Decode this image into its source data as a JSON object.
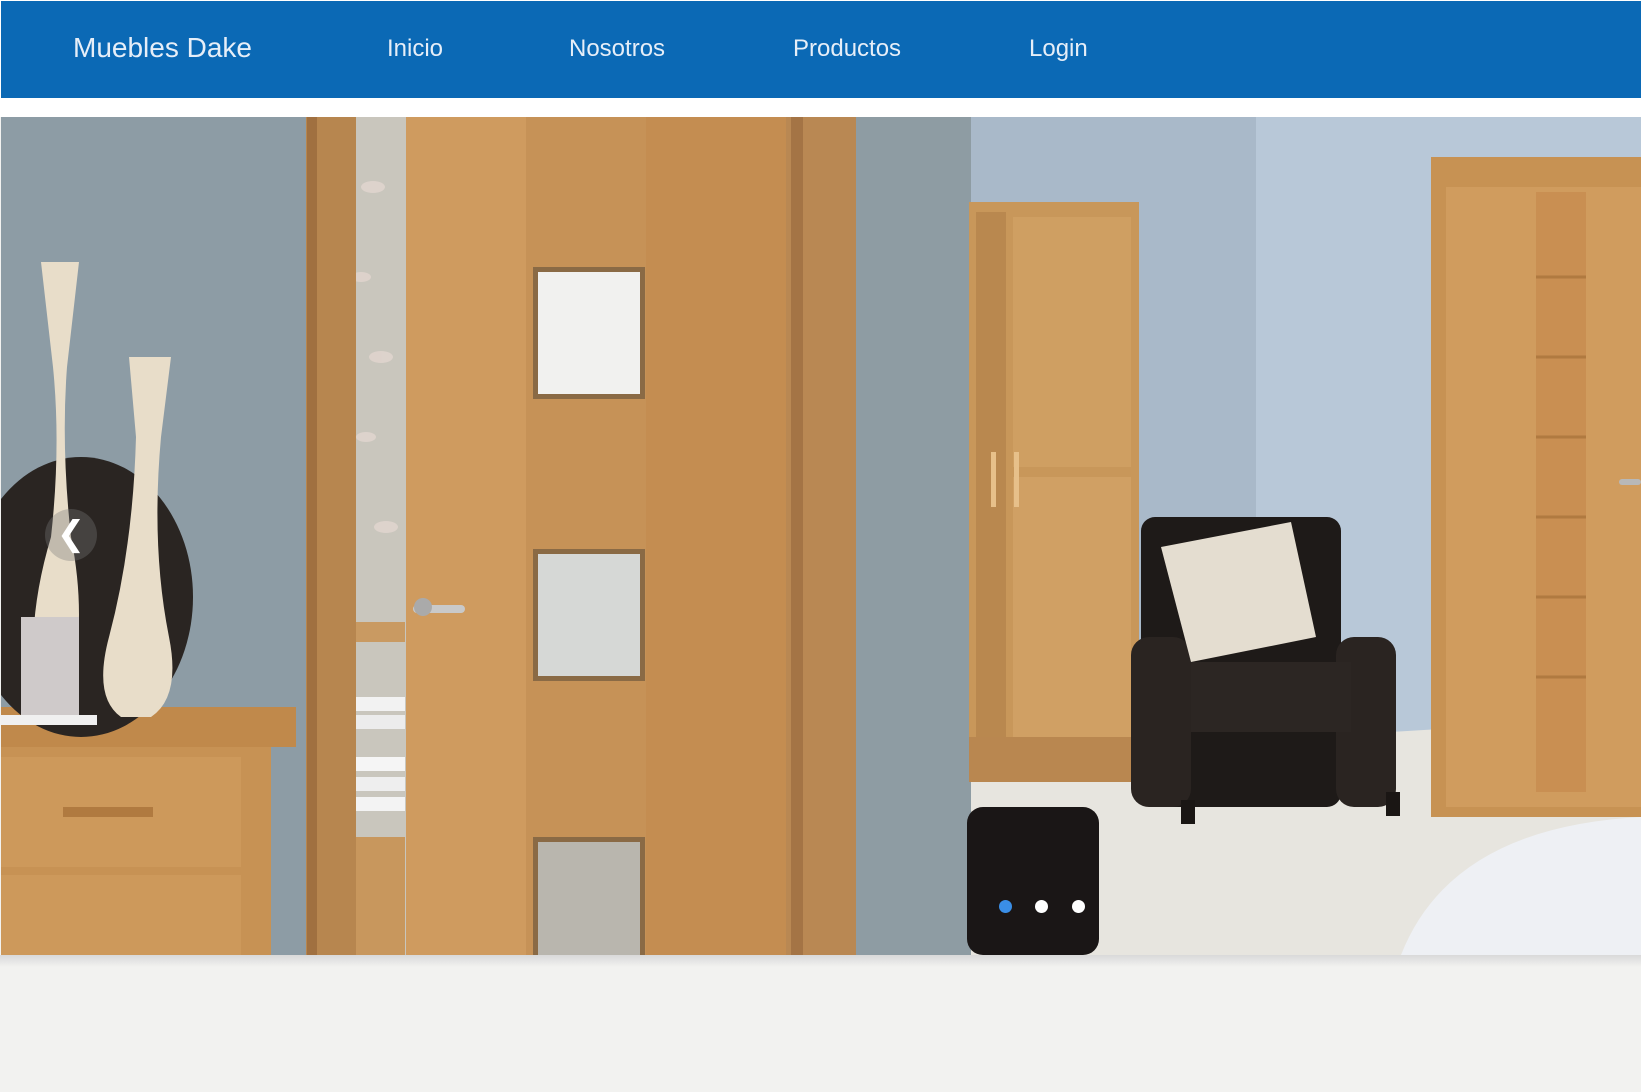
{
  "navbar": {
    "brand": "Muebles Dake",
    "links": [
      {
        "label": "Inicio"
      },
      {
        "label": "Nosotros"
      },
      {
        "label": "Productos"
      },
      {
        "label": "Login"
      }
    ],
    "background_color": "#0b69b5",
    "text_color": "#e6eef8"
  },
  "carousel": {
    "prev_arrow": "❮",
    "prev_icon": "chevron-left-icon",
    "active_index": 0,
    "slide_count": 3,
    "active_dot_color": "#3a8ee6",
    "inactive_dot_color": "#ffffff"
  },
  "page": {
    "background_color": "#f2f2f0"
  }
}
